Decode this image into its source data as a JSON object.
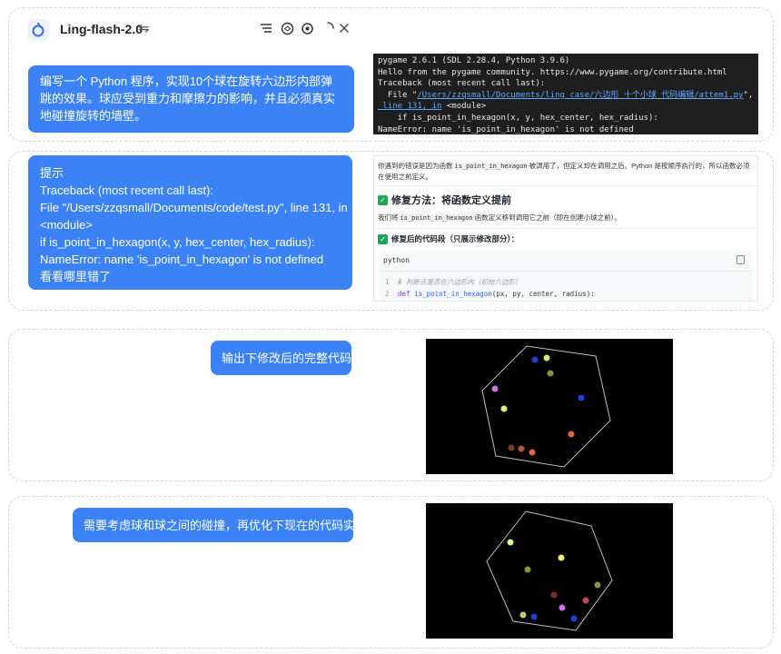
{
  "header": {
    "app_title": "Ling-flash-2.0",
    "swap_glyph": "⇋",
    "icons": [
      "filter-icon",
      "chatgpt-icon",
      "settings-icon",
      "loading-icon",
      "close-icon"
    ]
  },
  "messages": [
    {
      "role": "user",
      "text": "编写一个 Python 程序，实现10个球在旋转六边形内部弹跳的效果。球应受到重力和摩擦力的影响，并且必须真实地碰撞旋转的墙壁。"
    },
    {
      "role": "user",
      "lines": [
        "提示",
        "Traceback (most recent call last):",
        "File \"/Users/zzqsmall/Documents/code/test.py\", line 131, in",
        "<module>",
        "if is_point_in_hexagon(x, y, hex_center, hex_radius):",
        "NameError: name 'is_point_in_hexagon' is not defined",
        "看看哪里错了"
      ]
    },
    {
      "role": "user",
      "text": "输出下修改后的完整代码"
    },
    {
      "role": "user",
      "text": "需要考虑球和球之间的碰撞，再优化下现在的代码实现"
    }
  ],
  "terminal": {
    "line1": "pygame 2.6.1 (SDL 2.28.4, Python 3.9.6)",
    "line2": "Hello from the pygame community. https://www.pygame.org/contribute.html",
    "line3": "Traceback (most recent call last):",
    "line4_prefix": "  File \"",
    "line4_link": "/Users/zzqsmall/Documents/ling_case/六边形_十个小球_代码编辑/attem1.py",
    "line4_suffix": "\",",
    "line5_link": " line 131, in",
    "line5_suffix": " <module>",
    "line6": "    if is_point_in_hexagon(x, y, hex_center, hex_radius):",
    "line7": "NameError: name 'is_point_in_hexagon' is not defined"
  },
  "response": {
    "intro_a": "你遇到的错误是因为函数",
    "intro_code": "is_point_in_hexagon",
    "intro_b": "被调用了，但定义却在调用之后。Python 是按顺序执行的，所以函数必须在使用之前定义。",
    "heading1": "修复方法：将函数定义提前",
    "p2_a": "我们将",
    "p2_code": "is_point_in_hexagon",
    "p2_b": "函数定义移到调用它之前（即在创建小球之前）。",
    "heading2": "修复后的代码段（只展示修改部分）：",
    "code_lang": "python",
    "code_ln1": "1",
    "code_line1": "# 判断点是否在六边形内（初始六边形）",
    "code_ln2": "2",
    "code_kw": "def",
    "code_fn": "is_point_in_hexagon",
    "code_args": "(px, py, center, radius):"
  },
  "colors": {
    "bubble": "#3b82f6",
    "terminal_bg": "#1e1e1e",
    "sim_bg": "#000000",
    "check": "#22a55b"
  }
}
